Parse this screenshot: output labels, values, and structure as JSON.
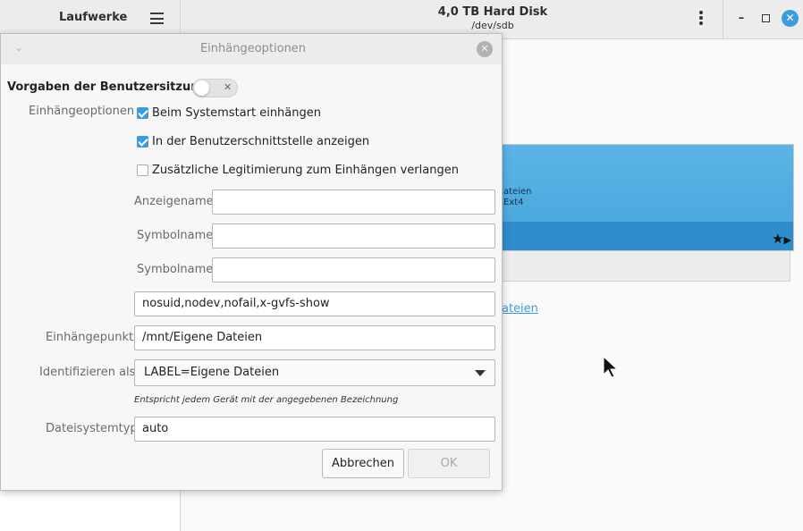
{
  "app": {
    "sidebar_title": "Laufwerke",
    "device_title": "4,0 TB Hard Disk",
    "device_path": "/dev/sdb"
  },
  "background": {
    "volume_text_line1": "ateien",
    "volume_text_line2": "Ext4",
    "link_text": "ateien",
    "accent_color": "#3d9be0"
  },
  "dialog": {
    "title": "Einhängeoptionen",
    "session_defaults_label": "Vorgaben der Benutzersitzung",
    "session_defaults_on": false,
    "mount_options_label": "Einhängeoptionen",
    "checkboxes": [
      {
        "label": "Beim Systemstart einhängen",
        "checked": true
      },
      {
        "label": "In der Benutzerschnittstelle anzeigen",
        "checked": true
      },
      {
        "label": "Zusätzliche Legitimierung zum Einhängen verlangen",
        "checked": false
      }
    ],
    "display_name_label": "Anzeigename",
    "display_name_value": "",
    "icon_name_label": "Symbolname",
    "icon_name_value": "",
    "symbolic_icon_label": "Symbolname",
    "symbolic_icon_value": "",
    "options_value": "nosuid,nodev,nofail,x-gvfs-show",
    "mount_point_label": "Einhängepunkt",
    "mount_point_value": "/mnt/Eigene Dateien",
    "identify_as_label": "Identifizieren als",
    "identify_as_value": "LABEL=Eigene Dateien",
    "identify_hint": "Entspricht jedem Gerät mit der angegebenen Bezeichnung",
    "fs_type_label": "Dateisystemtyp",
    "fs_type_value": "auto",
    "cancel_label": "Abbrechen",
    "ok_label": "OK"
  }
}
